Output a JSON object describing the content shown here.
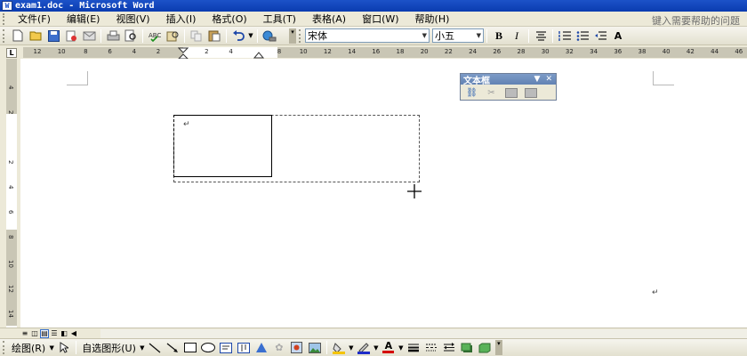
{
  "window": {
    "title": "exam1.doc - Microsoft Word"
  },
  "menubar": {
    "items": [
      "文件(F)",
      "编辑(E)",
      "视图(V)",
      "插入(I)",
      "格式(O)",
      "工具(T)",
      "表格(A)",
      "窗口(W)",
      "帮助(H)"
    ],
    "help_placeholder": "键入需要帮助的问题"
  },
  "toolbar": {
    "font_name": "宋体",
    "font_size": "小五",
    "bold_label": "B",
    "italic_label": "I",
    "icons": [
      "new-icon",
      "open-icon",
      "save-icon",
      "permission-icon",
      "email-icon",
      "print-icon",
      "print-preview-icon",
      "spelling-icon",
      "research-icon",
      "cut-icon",
      "copy-icon",
      "paste-icon",
      "undo-icon",
      "hyperlink-icon"
    ]
  },
  "ruler": {
    "corner_label": "L",
    "horizontal_ticks": [
      "12",
      "10",
      "8",
      "6",
      "4",
      "2",
      "",
      "2",
      "4",
      "",
      "8",
      "10",
      "12",
      "14",
      "16",
      "18",
      "20",
      "22",
      "24",
      "26",
      "28",
      "30",
      "32",
      "34",
      "36",
      "38",
      "40",
      "42",
      "44",
      "46"
    ],
    "vertical_ticks": [
      "4",
      "2",
      "",
      "2",
      "4",
      "6",
      "8",
      "10",
      "12",
      "14"
    ]
  },
  "textbox_toolbar": {
    "title": "文本框",
    "icons": [
      "create-link-icon",
      "break-link-icon",
      "previous-textbox-icon",
      "next-textbox-icon"
    ]
  },
  "document": {
    "paragraph_mark": "↵"
  },
  "drawbar": {
    "draw_label": "绘图(R)",
    "autoshapes_label": "自选图形(U)",
    "icons": [
      "select-pointer-icon",
      "line-icon",
      "arrow-icon",
      "rectangle-icon",
      "oval-icon",
      "textbox-icon",
      "vertical-textbox-icon",
      "wordart-icon",
      "diagram-icon",
      "clipart-icon",
      "picture-icon",
      "fill-color-icon",
      "line-color-icon",
      "font-color-icon",
      "line-style-icon",
      "dash-style-icon",
      "arrow-style-icon",
      "shadow-icon",
      "3d-icon"
    ],
    "font_color_letter": "A"
  },
  "colors": {
    "title_bar": "#0a3cb0",
    "chrome": "#ece9d8",
    "fill_color": "#f4c400",
    "line_color": "#1d2cc8",
    "font_color": "#d40000"
  }
}
